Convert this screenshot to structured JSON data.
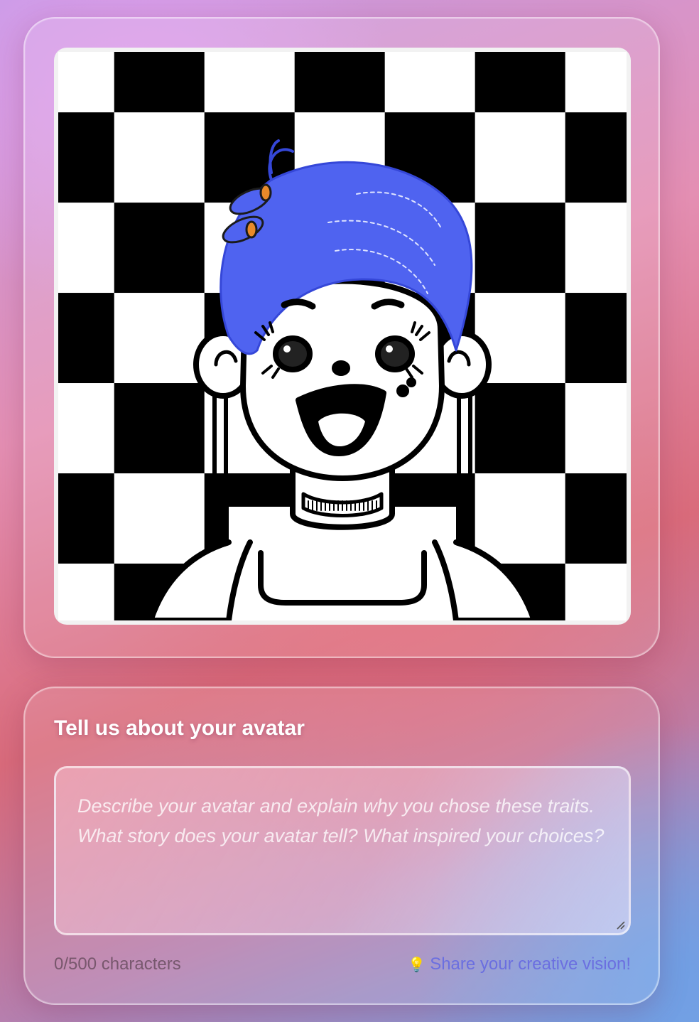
{
  "avatar": {
    "alt": "avatar"
  },
  "description": {
    "title": "Tell us about your avatar",
    "placeholder": "Describe your avatar and explain why you chose these traits. What story does your avatar tell? What inspired your choices?",
    "value": "",
    "char_count": "0/500 characters",
    "tip_icon": "lightbulb-icon",
    "tip_text": "Share your creative vision!"
  },
  "colors": {
    "hair": "#4f63f0",
    "tip_text": "#6b6fe0"
  }
}
